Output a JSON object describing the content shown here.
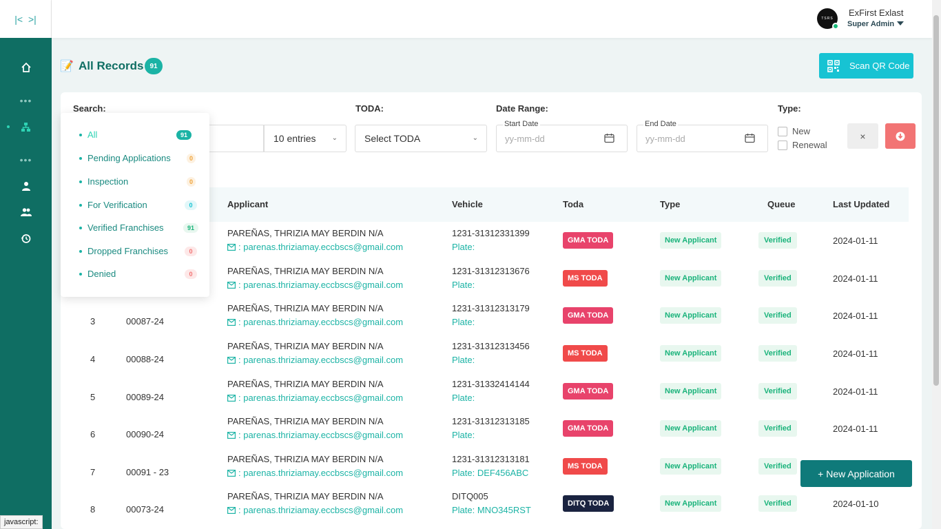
{
  "header": {
    "user_name": "ExFirst Exlast",
    "user_role": "Super Admin",
    "avatar_text": "TSRS"
  },
  "sidebar": {
    "items": [
      {
        "icon": "home-icon"
      },
      {
        "icon": "sitemap-icon"
      },
      {
        "icon": "user-icon"
      },
      {
        "icon": "users-icon"
      },
      {
        "icon": "history-icon"
      }
    ]
  },
  "page": {
    "title": "All Records",
    "count": "91",
    "scan_label": "Scan QR Code"
  },
  "filters": {
    "search_label": "Search:",
    "entries_value": "10 entries",
    "toda_label": "TODA:",
    "toda_value": "Select TODA",
    "date_range_label": "Date Range:",
    "start_label": "Start Date",
    "end_label": "End Date",
    "date_placeholder": "yy-mm-dd",
    "type_label": "Type:",
    "type_options": [
      "New",
      "Renewal"
    ],
    "clear_label": "×"
  },
  "status_menu": {
    "items": [
      {
        "label": "All",
        "count": "91",
        "color": "#1bb3a5"
      },
      {
        "label": "Pending Applications",
        "count": "0",
        "color": "#f0a33a"
      },
      {
        "label": "Inspection",
        "count": "0",
        "color": "#f0a33a"
      },
      {
        "label": "For Verification",
        "count": "0",
        "color": "#17c3d3"
      },
      {
        "label": "Verified Franchises",
        "count": "91",
        "color": "#1ab37b"
      },
      {
        "label": "Dropped Franchises",
        "count": "0",
        "color": "#f27474"
      },
      {
        "label": "Denied",
        "count": "0",
        "color": "#f27474"
      }
    ]
  },
  "table": {
    "columns": [
      "Applicant",
      "Vehicle",
      "Toda",
      "Type",
      "Queue",
      "Last Updated"
    ],
    "rows": [
      {
        "no": "",
        "id": "",
        "name": "PAREÑAS, THRIZIA MAY BERDIN N/A",
        "email": ": parenas.thriziamay.eccbscs@gmail.com",
        "vehicle": "1231-31312331399",
        "plate": "Plate:",
        "toda": "GMA TODA",
        "toda_color": "#e8436b",
        "type": "New Applicant",
        "queue": "Verified",
        "updated": "2024-01-11"
      },
      {
        "no": "",
        "id": "",
        "name": "PAREÑAS, THRIZIA MAY BERDIN N/A",
        "email": ": parenas.thriziamay.eccbscs@gmail.com",
        "vehicle": "1231-31312313676",
        "plate": "Plate:",
        "toda": "MS TODA",
        "toda_color": "#f04a4a",
        "type": "New Applicant",
        "queue": "Verified",
        "updated": "2024-01-11"
      },
      {
        "no": "3",
        "id": "00087-24",
        "name": "PAREÑAS, THRIZIA MAY BERDIN N/A",
        "email": ": parenas.thriziamay.eccbscs@gmail.com",
        "vehicle": "1231-31312313179",
        "plate": "Plate:",
        "toda": "GMA TODA",
        "toda_color": "#e8436b",
        "type": "New Applicant",
        "queue": "Verified",
        "updated": "2024-01-11"
      },
      {
        "no": "4",
        "id": "00088-24",
        "name": "PAREÑAS, THRIZIA MAY BERDIN N/A",
        "email": ": parenas.thriziamay.eccbscs@gmail.com",
        "vehicle": "1231-31312313456",
        "plate": "Plate:",
        "toda": "MS TODA",
        "toda_color": "#f04a4a",
        "type": "New Applicant",
        "queue": "Verified",
        "updated": "2024-01-11"
      },
      {
        "no": "5",
        "id": "00089-24",
        "name": "PAREÑAS, THRIZIA MAY BERDIN N/A",
        "email": ": parenas.thriziamay.eccbscs@gmail.com",
        "vehicle": "1231-31332414144",
        "plate": "Plate:",
        "toda": "GMA TODA",
        "toda_color": "#e8436b",
        "type": "New Applicant",
        "queue": "Verified",
        "updated": "2024-01-11"
      },
      {
        "no": "6",
        "id": "00090-24",
        "name": "PAREÑAS, THRIZIA MAY BERDIN N/A",
        "email": ": parenas.thriziamay.eccbscs@gmail.com",
        "vehicle": "1231-31312313185",
        "plate": "Plate:",
        "toda": "GMA TODA",
        "toda_color": "#e8436b",
        "type": "New Applicant",
        "queue": "Verified",
        "updated": "2024-01-11"
      },
      {
        "no": "7",
        "id": "00091 - 23",
        "name": "PAREÑAS, THRIZIA MAY BERDIN N/A",
        "email": ": parenas.thriziamay.eccbscs@gmail.com",
        "vehicle": "1231-31312313181",
        "plate": "Plate: DEF456ABC",
        "toda": "MS TODA",
        "toda_color": "#f04a4a",
        "type": "New Applicant",
        "queue": "Verified",
        "updated": ""
      },
      {
        "no": "8",
        "id": "00073-24",
        "name": "PAREÑAS, THRIZIA MAY BERDIN N/A",
        "email": ": parenas.thriziamay.eccbscs@gmail.com",
        "vehicle": "DITQ005",
        "plate": "Plate: MNO345RST",
        "toda": "DITQ TODA",
        "toda_color": "#1a2340",
        "type": "New Applicant",
        "queue": "Verified",
        "updated": "2024-01-10"
      }
    ]
  },
  "new_application_label": "+ New Application",
  "status_bar_text": "javascript:"
}
